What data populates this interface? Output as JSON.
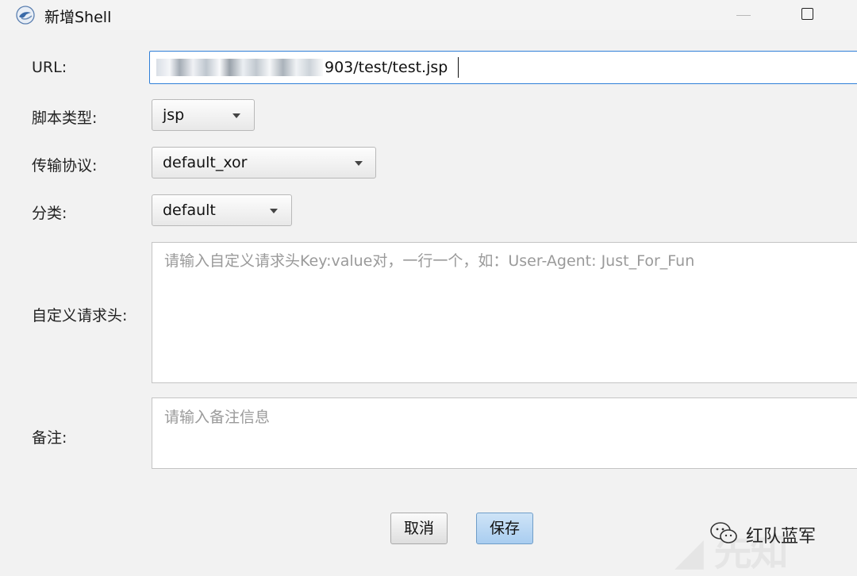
{
  "window": {
    "title": "新增Shell",
    "icon": "app-logo-icon"
  },
  "form": {
    "url": {
      "label": "URL:",
      "value_visible": "903/test/test.jsp",
      "value_note": "leading portion blurred"
    },
    "script_type": {
      "label": "脚本类型:",
      "value": "jsp"
    },
    "transport": {
      "label": "传输协议:",
      "value": "default_xor"
    },
    "category": {
      "label": "分类:",
      "value": "default"
    },
    "custom_headers": {
      "label": "自定义请求头:",
      "placeholder": "请输入自定义请求头Key:value对，一行一个，如：User-Agent: Just_For_Fun"
    },
    "remark": {
      "label": "备注:",
      "placeholder": "请输入备注信息"
    }
  },
  "buttons": {
    "cancel": "取消",
    "save": "保存"
  },
  "watermark": {
    "text": "红队蓝军"
  }
}
